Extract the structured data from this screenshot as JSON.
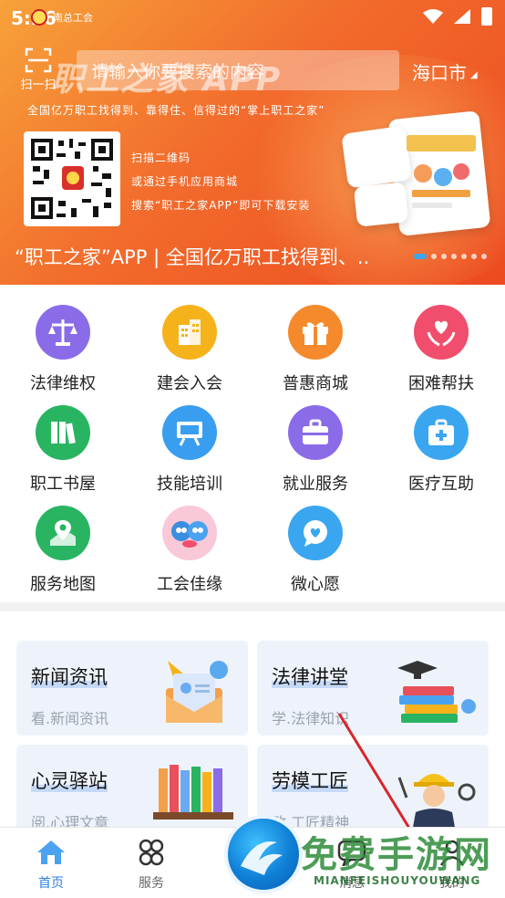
{
  "status_bar": {
    "time": "5:26",
    "union_name": "南总工会"
  },
  "header": {
    "scan_label": "扫一扫",
    "search_placeholder": "请输入你要搜索的内容",
    "city": "海口市",
    "brand": "职工之家 APP"
  },
  "banner": {
    "slogan": "全国亿万职工找得到、靠得住、信得过的“掌上职工之家”",
    "qr_lines": [
      "扫描二维码",
      "或通过手机应用商城",
      "搜索“职工之家APP”即可下载安装"
    ],
    "caption": "“职工之家”APP | 全国亿万职工找得到、..",
    "dot_count": 7
  },
  "grid": [
    {
      "label": "法律维权",
      "icon": "scales-icon",
      "color": "#8a6be8"
    },
    {
      "label": "建会入会",
      "icon": "building-icon",
      "color": "#f6b21a"
    },
    {
      "label": "普惠商城",
      "icon": "gift-icon",
      "color": "#f58a2c"
    },
    {
      "label": "困难帮扶",
      "icon": "heart-hands-icon",
      "color": "#f04e6c"
    },
    {
      "label": "职工书屋",
      "icon": "books-icon",
      "color": "#29b462"
    },
    {
      "label": "技能培训",
      "icon": "presentation-board-icon",
      "color": "#3a9ef0"
    },
    {
      "label": "就业服务",
      "icon": "briefcase-icon",
      "color": "#8a6be8"
    },
    {
      "label": "医疗互助",
      "icon": "medical-kit-icon",
      "color": "#3aa6f0"
    },
    {
      "label": "服务地图",
      "icon": "map-pin-icon",
      "color": "#29b462"
    },
    {
      "label": "工会佳缘",
      "icon": "mascot-couple-icon",
      "color": "#f9c9d8"
    },
    {
      "label": "微心愿",
      "icon": "chat-heart-icon",
      "color": "#3aa6f0"
    }
  ],
  "cards": [
    {
      "title": "新闻资讯",
      "subtitle": "看.新闻资讯"
    },
    {
      "title": "法律讲堂",
      "subtitle": "学.法律知识"
    },
    {
      "title": "心灵驿站",
      "subtitle": "阅.心理文章"
    },
    {
      "title": "劳模工匠",
      "subtitle": "致.工匠精神"
    }
  ],
  "nav": {
    "home": "首页",
    "services": "服务",
    "messages": "消息",
    "mine": "我的"
  },
  "watermark": {
    "main": "免费手游网",
    "sub": "MIANFEISHOUYOUWANG"
  },
  "colors": {
    "banner_start": "#f7a23a",
    "banner_end": "#ec4a1f",
    "active_nav": "#2a7fe0",
    "card_bg": "#eef3fb"
  }
}
